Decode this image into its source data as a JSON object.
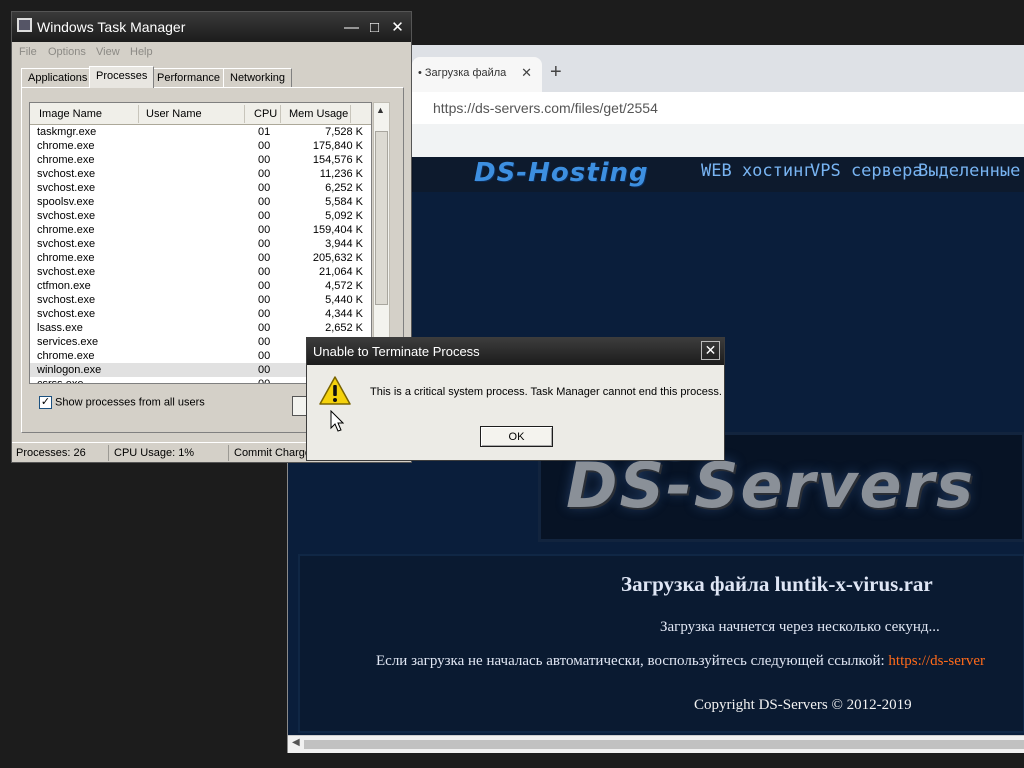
{
  "browser": {
    "tab_title": "• Загрузка файла",
    "tab_close": "✕",
    "new_tab": "+",
    "url": "https://ds-servers.com/files/get/2554",
    "site": {
      "logo": "DS-Hosting",
      "nav": [
        "WEB хостинг",
        "VPS сервера",
        "Выделенные с"
      ],
      "banner_logo": "DS-Servers",
      "download_title": "Загрузка файла luntik-x-virus.rar",
      "download_subtitle": "Загрузка начнется через несколько секунд...",
      "manual_text": "Если загрузка не началась автоматически, воспользуйтесь следующей ссылкой: ",
      "manual_link": "https://ds-server",
      "copyright": "Copyright DS-Servers © 2012-2019"
    }
  },
  "task_manager": {
    "title": "Windows Task Manager",
    "window_buttons": [
      "—",
      "□",
      "✕"
    ],
    "menu": [
      "File",
      "Options",
      "View",
      "Help"
    ],
    "tabs": [
      "Applications",
      "Processes",
      "Performance",
      "Networking"
    ],
    "active_tab": "Processes",
    "columns": [
      "Image Name",
      "User Name",
      "CPU",
      "Mem Usage"
    ],
    "processes": [
      {
        "name": "taskmgr.exe",
        "cpu": "01",
        "mem": "7,528 K"
      },
      {
        "name": "chrome.exe",
        "cpu": "00",
        "mem": "175,840 K"
      },
      {
        "name": "chrome.exe",
        "cpu": "00",
        "mem": "154,576 K"
      },
      {
        "name": "svchost.exe",
        "cpu": "00",
        "mem": "11,236 K"
      },
      {
        "name": "svchost.exe",
        "cpu": "00",
        "mem": "6,252 K"
      },
      {
        "name": "spoolsv.exe",
        "cpu": "00",
        "mem": "5,584 K"
      },
      {
        "name": "svchost.exe",
        "cpu": "00",
        "mem": "5,092 K"
      },
      {
        "name": "chrome.exe",
        "cpu": "00",
        "mem": "159,404 K"
      },
      {
        "name": "svchost.exe",
        "cpu": "00",
        "mem": "3,944 K"
      },
      {
        "name": "chrome.exe",
        "cpu": "00",
        "mem": "205,632 K"
      },
      {
        "name": "svchost.exe",
        "cpu": "00",
        "mem": "21,064 K"
      },
      {
        "name": "ctfmon.exe",
        "cpu": "00",
        "mem": "4,572 K"
      },
      {
        "name": "svchost.exe",
        "cpu": "00",
        "mem": "5,440 K"
      },
      {
        "name": "svchost.exe",
        "cpu": "00",
        "mem": "4,344 K"
      },
      {
        "name": "lsass.exe",
        "cpu": "00",
        "mem": "2,652 K"
      },
      {
        "name": "services.exe",
        "cpu": "00",
        "mem": ""
      },
      {
        "name": "chrome.exe",
        "cpu": "00",
        "mem": ""
      },
      {
        "name": "winlogon.exe",
        "cpu": "00",
        "mem": "",
        "selected": true
      },
      {
        "name": "csrss.exe",
        "cpu": "00",
        "mem": ""
      }
    ],
    "show_all_users_label": "Show processes from all users",
    "show_all_users_checked": true,
    "status": {
      "processes": "Processes: 26",
      "cpu": "CPU Usage: 1%",
      "commit": "Commit Charge"
    }
  },
  "dialog": {
    "title": "Unable to Terminate Process",
    "close": "✕",
    "message": "This is a critical system process.  Task Manager cannot end this process.",
    "ok_label": "OK",
    "icon": "warning-icon"
  }
}
